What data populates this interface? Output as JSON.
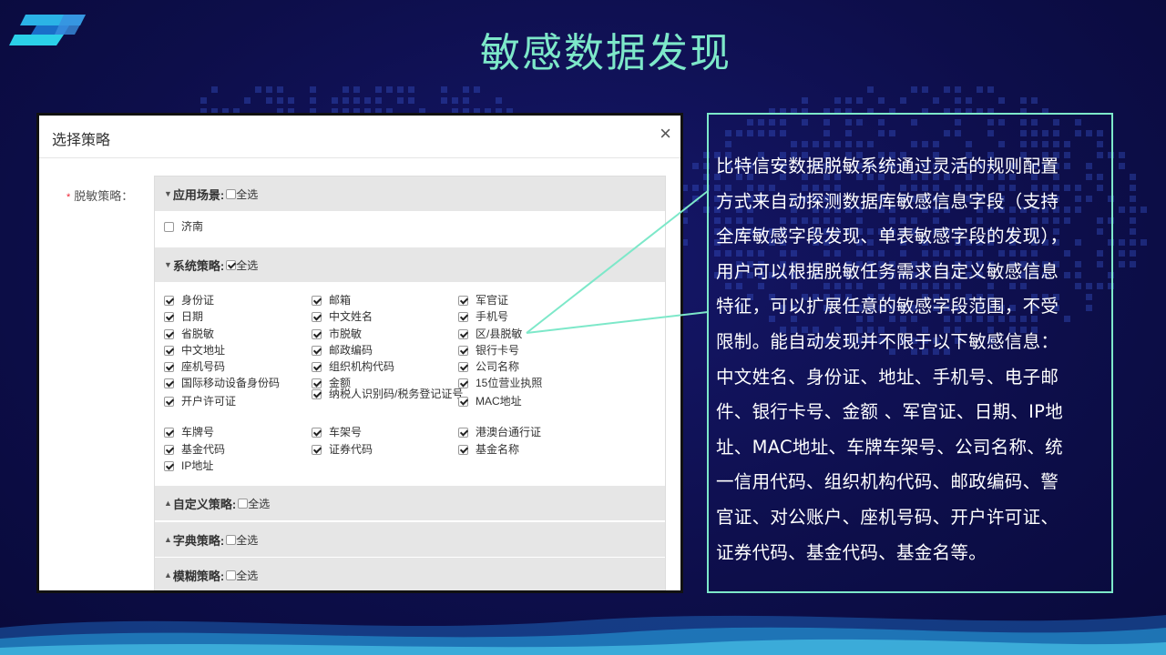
{
  "slide": {
    "title": "敏感数据发现"
  },
  "dialog": {
    "title": "选择策略",
    "close_icon": "×",
    "field_label": "脱敏策略：",
    "required_mark": "*",
    "sections": {
      "scene": {
        "title": "应用场景:",
        "select_all": "全选",
        "select_all_checked": false,
        "expanded": true,
        "items": [
          {
            "label": "济南",
            "checked": false
          }
        ]
      },
      "system": {
        "title": "系统策略:",
        "select_all": "全选",
        "select_all_checked": true,
        "expanded": true,
        "items": [
          "身份证",
          "邮箱",
          "军官证",
          "日期",
          "中文姓名",
          "手机号",
          "省脱敏",
          "市脱敏",
          "区/县脱敏",
          "中文地址",
          "邮政编码",
          "银行卡号",
          "座机号码",
          "组织机构代码",
          "公司名称",
          "国际移动设备身份码",
          "金额",
          "15位营业执照",
          "开户许可证",
          "纳税人识别码/税务登记证号",
          "MAC地址",
          "车牌号",
          "车架号",
          "港澳台通行证",
          "基金代码",
          "证券代码",
          "基金名称",
          "IP地址"
        ]
      },
      "custom": {
        "title": "自定义策略:",
        "select_all": "全选",
        "select_all_checked": false,
        "expanded": false
      },
      "dict": {
        "title": "字典策略:",
        "select_all": "全选",
        "select_all_checked": false,
        "expanded": false
      },
      "fuzzy": {
        "title": "模糊策略:",
        "select_all": "全选",
        "select_all_checked": false,
        "expanded": false
      }
    }
  },
  "description": {
    "lines": [
      "比特信安数据脱敏系统通过灵活的规则配置",
      "方式来自动探测数据库敏感信息字段（支持",
      "全库敏感字段发现、单表敏感字段的发现），",
      "用户可以根据脱敏任务需求自定义敏感信息",
      "特征，可以扩展任意的敏感字段范围，不受",
      "限制。能自动发现并不限于以下敏感信息：",
      "中文姓名、身份证、地址、手机号、电子邮",
      "件、银行卡号、金额 、军官证、日期、IP地",
      "址、MAC地址、车牌车架号、公司名称、统",
      "一信用代码、组织机构代码、邮政编码、警",
      "官证、对公账户、座机号码、开户许可证、",
      "证券代码、基金代码、基金名等。"
    ]
  },
  "colors": {
    "background": "#0d0e4a",
    "accent": "#7de8c9",
    "title": "#7de8c9",
    "text": "#ffffff"
  },
  "icons": [
    "logo-icon",
    "close-icon",
    "triangle-down-icon",
    "triangle-up-icon",
    "checkbox-icon"
  ]
}
